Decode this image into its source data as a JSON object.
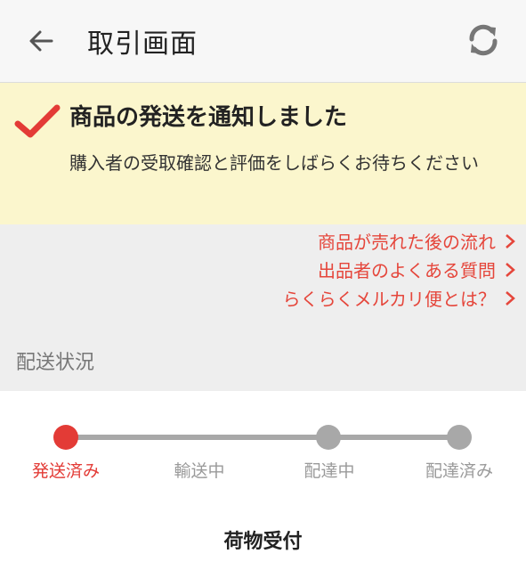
{
  "header": {
    "back_icon": "arrow-left-icon",
    "title": "取引画面",
    "refresh_icon": "refresh-icon"
  },
  "notice": {
    "icon": "checkmark-icon",
    "icon_color": "#e33b36",
    "headline": "商品の発送を通知しました",
    "body": "購入者の受取確認と評価をしばらくお待ちください"
  },
  "links": [
    {
      "label": "商品が売れた後の流れ"
    },
    {
      "label": "出品者のよくある質問"
    },
    {
      "label": "らくらくメルカリ便とは？"
    }
  ],
  "link_color": "#e5463b",
  "section": {
    "label": "配送状況"
  },
  "tracker": {
    "steps": [
      {
        "label": "発送済み",
        "active": true
      },
      {
        "label": "輸送中",
        "active": false
      },
      {
        "label": "配達中",
        "active": false
      },
      {
        "label": "配達済み",
        "active": false
      }
    ],
    "current_status": "荷物受付"
  }
}
